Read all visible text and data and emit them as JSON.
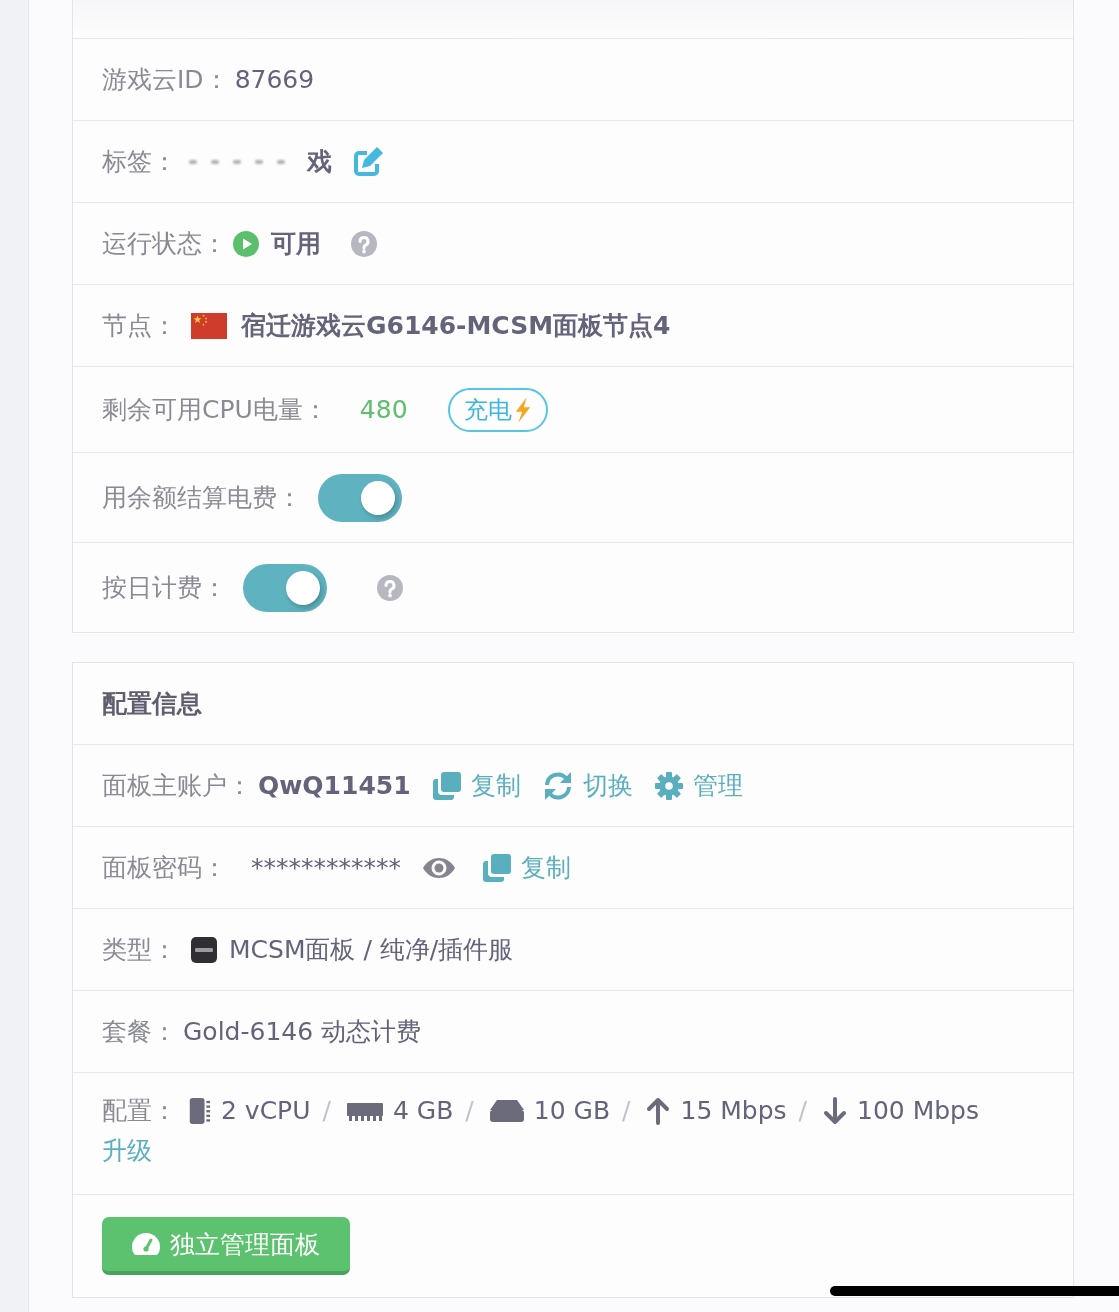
{
  "basic_info": {
    "fields": [
      {
        "kind": "text",
        "label": "游戏云ID：",
        "value": "87669"
      },
      {
        "kind": "tag",
        "label": "标签：",
        "redacted": true,
        "value": "戏"
      },
      {
        "kind": "status",
        "label": "运行状态：",
        "value": "可用",
        "help": true
      },
      {
        "kind": "node",
        "label": "节点：",
        "value": "宿迁游戏云G6146-MCSM面板节点4"
      },
      {
        "kind": "credit",
        "label": "剩余可用CPU电量：",
        "value": "480",
        "action": "充电"
      },
      {
        "kind": "toggle",
        "label": "用余额结算电费：",
        "on": true
      },
      {
        "kind": "toggle",
        "label": "按日计费：",
        "on": true,
        "help": true
      }
    ]
  },
  "config_info": {
    "title": "配置信息",
    "fields": [
      {
        "kind": "account",
        "label": "面板主账户：",
        "value": "QwQ11451",
        "actions": [
          {
            "kind": "copy",
            "label": "复制"
          },
          {
            "kind": "switch",
            "label": "切换"
          },
          {
            "kind": "manage",
            "label": "管理"
          }
        ]
      },
      {
        "kind": "password",
        "label": "面板密码：",
        "value": "************",
        "actions": [
          {
            "kind": "copy",
            "label": "复制"
          }
        ]
      },
      {
        "kind": "type",
        "label": "类型：",
        "value": "MCSM面板 / 纯净/插件服"
      },
      {
        "kind": "text",
        "label": "套餐：",
        "value": "Gold-6146 动态计费"
      },
      {
        "kind": "specs",
        "label": "配置：",
        "specs": [
          {
            "kind": "cpu",
            "text": "2 vCPU"
          },
          {
            "kind": "memory",
            "separator": "/",
            "text": "4 GB"
          },
          {
            "kind": "disk",
            "separator": "/",
            "text": "10 GB"
          },
          {
            "kind": "upload",
            "separator": "/",
            "text": "15 Mbps"
          },
          {
            "kind": "download",
            "separator": "/",
            "text": "100 Mbps"
          }
        ],
        "link": "升级"
      }
    ],
    "button": {
      "label": "独立管理面板"
    }
  }
}
